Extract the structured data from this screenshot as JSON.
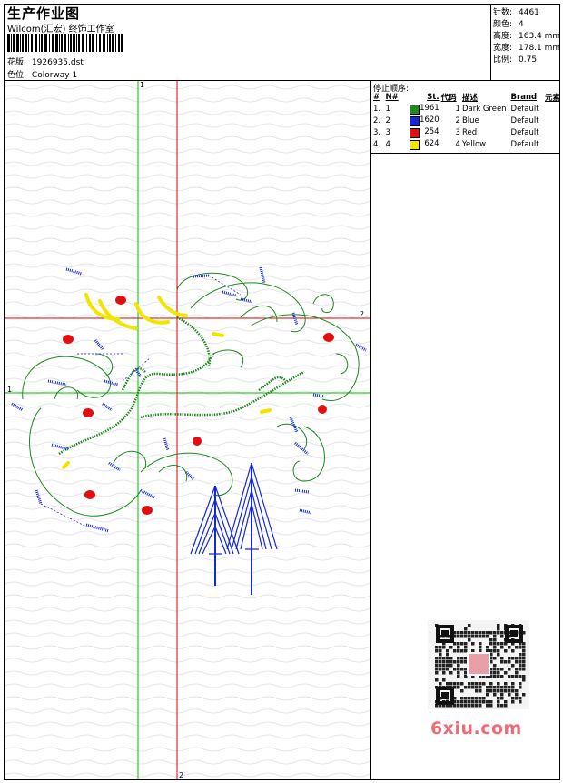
{
  "header": {
    "title": "生产作业图",
    "company": "Wilcom(汇宏) 终饰工作室",
    "design_label": "花版:",
    "design_value": "1926935.dst",
    "colorway_label": "色位:",
    "colorway_value": "Colorway 1"
  },
  "stats": [
    {
      "label": "针数:",
      "value": "4461"
    },
    {
      "label": "颜色:",
      "value": "4"
    },
    {
      "label": "高度:",
      "value": "163.4 mm"
    },
    {
      "label": "宽度:",
      "value": "178.1 mm"
    },
    {
      "label": "比例:",
      "value": "0.75"
    }
  ],
  "stop_sequence": {
    "title": "停止顺序:",
    "headers": [
      "#",
      "N#",
      "St.",
      "代码",
      "描述",
      "Brand",
      "元素"
    ],
    "rows": [
      {
        "num": "1.",
        "n": "1",
        "color": "#1a8a1a",
        "stitches": "1961",
        "code": "1",
        "desc": "Dark Green",
        "brand": "Default"
      },
      {
        "num": "2.",
        "n": "2",
        "color": "#1428d6",
        "stitches": "1620",
        "code": "2",
        "desc": "Blue",
        "brand": "Default"
      },
      {
        "num": "3.",
        "n": "3",
        "color": "#e01010",
        "stitches": "254",
        "code": "3",
        "desc": "Red",
        "brand": "Default"
      },
      {
        "num": "4.",
        "n": "4",
        "color": "#f2e600",
        "stitches": "624",
        "code": "4",
        "desc": "Yellow",
        "brand": "Default"
      }
    ]
  },
  "axes": {
    "green_top": "1",
    "green_left": "1",
    "red_right": "2",
    "red_bottom": "2"
  },
  "watermark": "6xiu.com",
  "colors": {
    "green": "#1a8a1a",
    "blue": "#1428d6",
    "red": "#e01010",
    "yellow": "#f2e600",
    "guide_green": "#00c000",
    "guide_red": "#e00000"
  }
}
